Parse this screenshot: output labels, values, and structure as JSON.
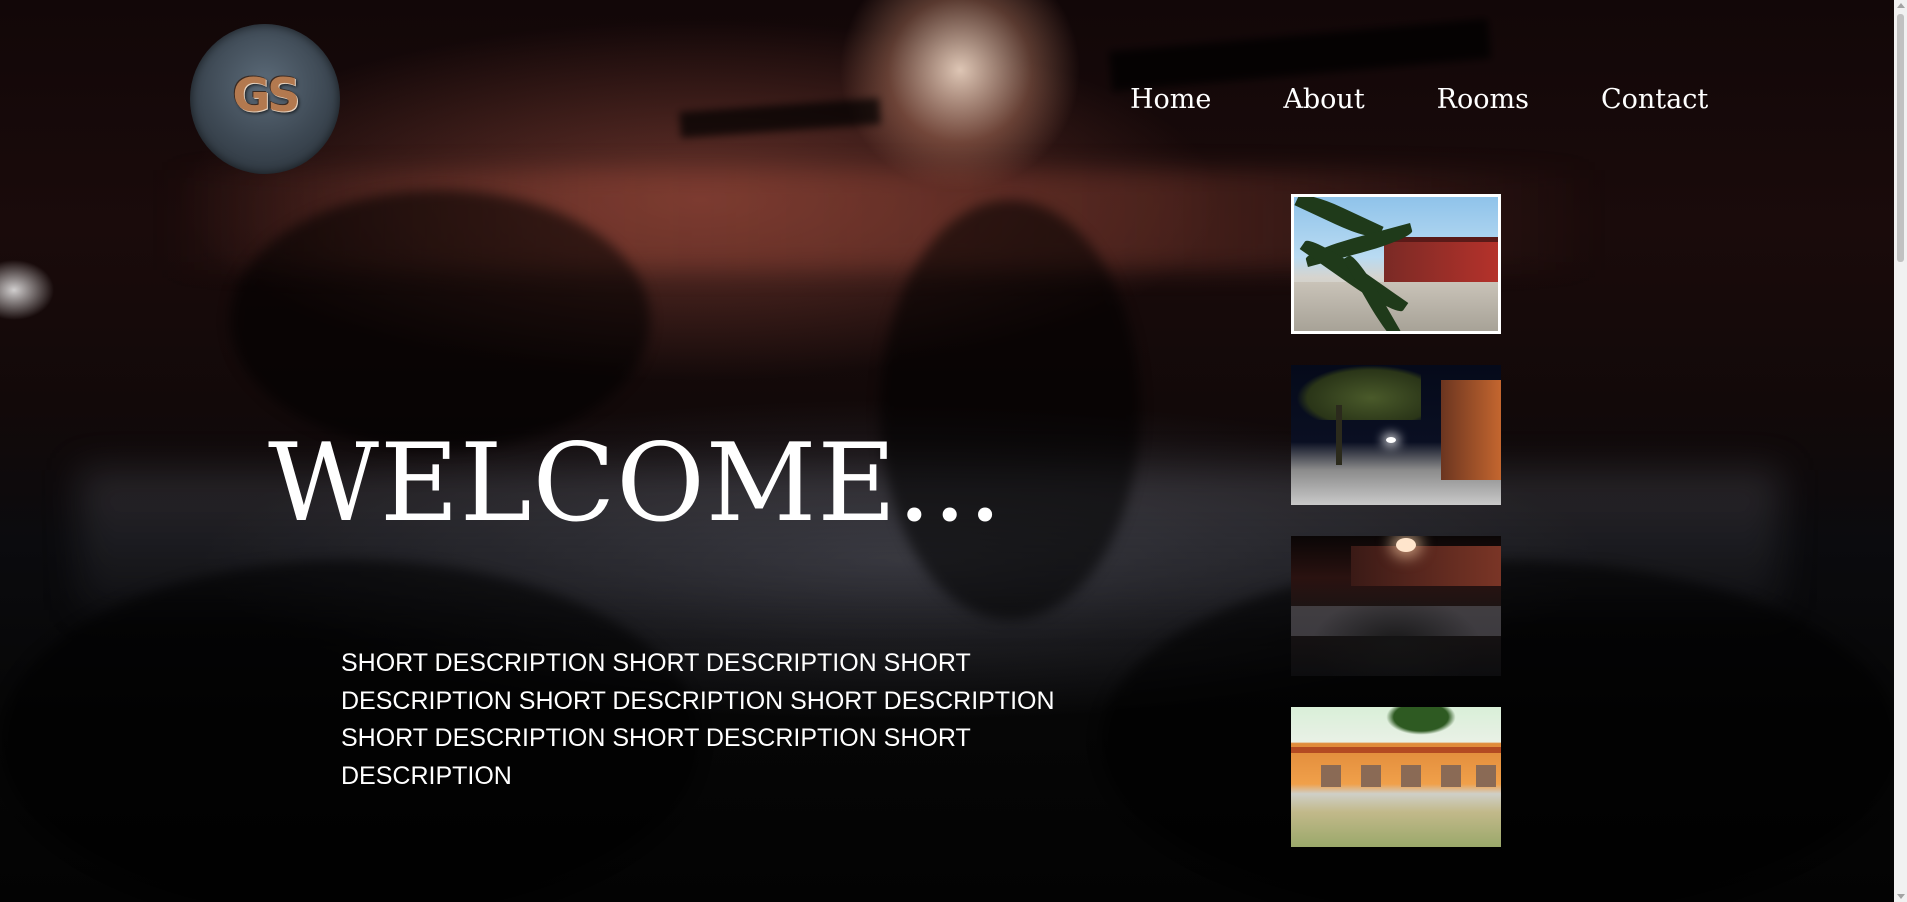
{
  "logo": {
    "text": "GS"
  },
  "nav": {
    "items": [
      {
        "label": "Home"
      },
      {
        "label": "About"
      },
      {
        "label": "Rooms"
      },
      {
        "label": "Contact"
      }
    ]
  },
  "hero": {
    "title": "WELCOME...",
    "description": "SHORT DESCRIPTION SHORT DESCRIPTION SHORT DESCRIPTION SHORT DESCRIPTION SHORT DESCRIPTION SHORT DESCRIPTION SHORT DESCRIPTION SHORT DESCRIPTION"
  },
  "gallery": {
    "selected_index": 0,
    "thumbnails": [
      {
        "scene": "daytime-palm-and-red-building"
      },
      {
        "scene": "night-street-with-palm"
      },
      {
        "scene": "night-orange-wall"
      },
      {
        "scene": "daytime-orange-building"
      }
    ]
  },
  "colors": {
    "text": "#ffffff",
    "selected_border": "#ffffff",
    "background": "#050304"
  }
}
